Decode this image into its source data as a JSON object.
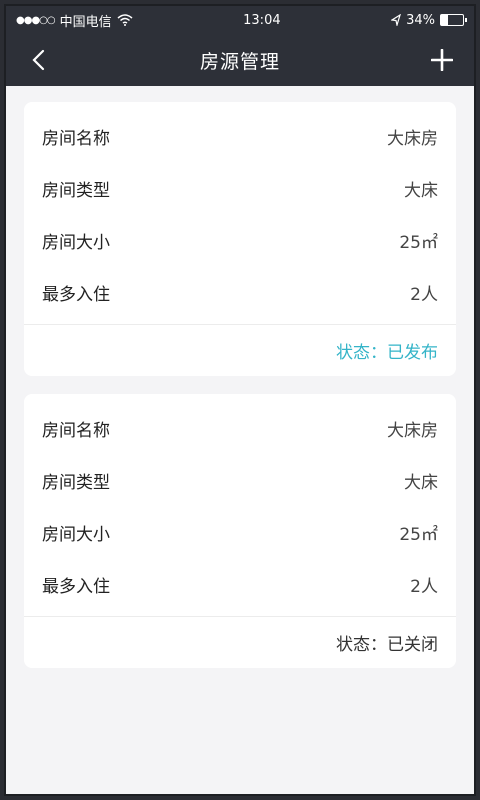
{
  "statusbar": {
    "carrier": "中国电信",
    "signal": "●●●○○",
    "time": "13:04",
    "battery_percent": "34%",
    "battery_level": 0.34
  },
  "navbar": {
    "title": "房源管理",
    "back_icon": "chevron-left-icon",
    "add_icon": "plus-icon"
  },
  "rooms": [
    {
      "fields": [
        {
          "label": "房间名称",
          "value": "大床房"
        },
        {
          "label": "房间类型",
          "value": "大床"
        },
        {
          "label": "房间大小",
          "value": "25㎡"
        },
        {
          "label": "最多入住",
          "value": "2人"
        }
      ],
      "status": "状态：已发布",
      "status_color": "#34b4c8"
    },
    {
      "fields": [
        {
          "label": "房间名称",
          "value": "大床房"
        },
        {
          "label": "房间类型",
          "value": "大床"
        },
        {
          "label": "房间大小",
          "value": "25㎡"
        },
        {
          "label": "最多入住",
          "value": "2人"
        }
      ],
      "status": "状态：已关闭",
      "status_color": "#333333"
    }
  ],
  "colors": {
    "header_bg": "#2d3038",
    "page_bg": "#f4f4f6",
    "accent": "#34b4c8"
  }
}
